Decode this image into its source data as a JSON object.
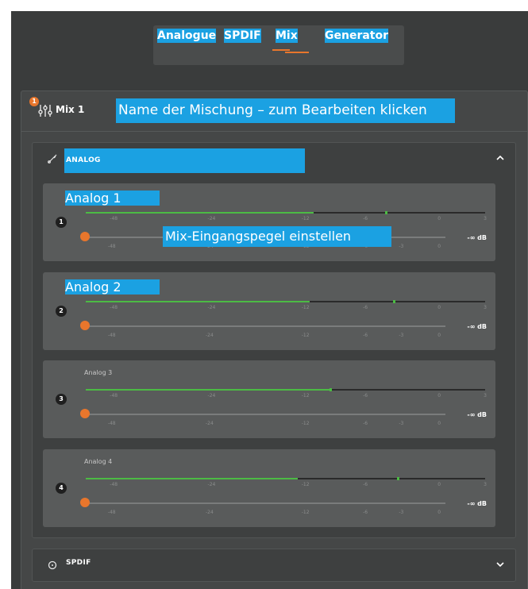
{
  "tabs": [
    "Analogue",
    "SPDIF",
    "Mix",
    "Generator"
  ],
  "active_tab": "Mix",
  "mix": {
    "badge": "1",
    "title": "Mix 1",
    "name_placeholder": "Name der Mischung – zum Bearbeiten klicken"
  },
  "sections": {
    "analog": {
      "label": "ANALOG",
      "icon": "instrument-cable-icon",
      "expanded": true
    },
    "spdif": {
      "label": "SPDIF",
      "icon": "circle-icon",
      "expanded": false
    }
  },
  "meter_ticks": [
    "-48",
    "-24",
    "-12",
    "-6",
    "0",
    "3"
  ],
  "fader_ticks": [
    "-48",
    "-24",
    "-12",
    "-6",
    "-3",
    "0"
  ],
  "channels": [
    {
      "number": "1",
      "name": "Analog 1",
      "level": 0.57,
      "peak": 0.75,
      "db": "-∞ dB"
    },
    {
      "number": "2",
      "name": "Analog 2",
      "level": 0.56,
      "peak": 0.77,
      "db": "-∞ dB"
    },
    {
      "number": "3",
      "name": "Analog 3",
      "level": 0.61,
      "peak": 0.61,
      "db": "-∞ dB"
    },
    {
      "number": "4",
      "name": "Analog 4",
      "level": 0.53,
      "peak": 0.78,
      "db": "-∞ dB"
    }
  ],
  "overlay_hint": "Mix-Eingangspegel einstellen",
  "colors": {
    "accent": "#e8762c",
    "meter": "#4cbb44",
    "highlight": "#1ba1e2"
  }
}
